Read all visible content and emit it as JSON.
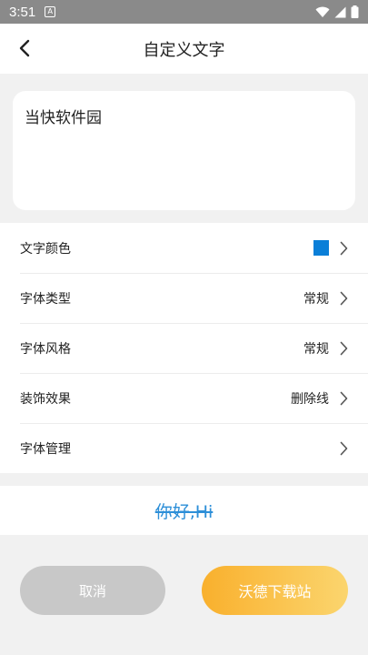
{
  "status_bar": {
    "time": "3:51",
    "notif_glyph": "A"
  },
  "header": {
    "title": "自定义文字"
  },
  "editor": {
    "text": "当快软件园"
  },
  "settings": [
    {
      "label": "文字颜色",
      "value": "",
      "swatch_color": "#0a7fd8"
    },
    {
      "label": "字体类型",
      "value": "常规"
    },
    {
      "label": "字体风格",
      "value": "常规"
    },
    {
      "label": "装饰效果",
      "value": "删除线"
    },
    {
      "label": "字体管理",
      "value": ""
    }
  ],
  "preview": {
    "text": "你好,Hi",
    "color": "#2d8fd8"
  },
  "buttons": {
    "cancel": "取消",
    "confirm": "沃德下载站"
  },
  "colors": {
    "accent_start": "#f9b02d",
    "accent_end": "#fbd56e",
    "cancel_bg": "#c8c8c8"
  }
}
